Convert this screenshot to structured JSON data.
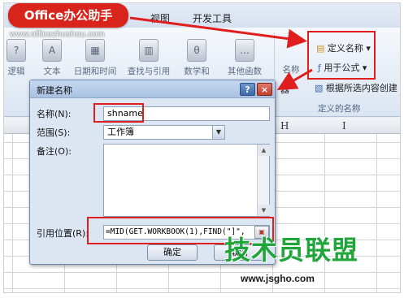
{
  "logo": {
    "text": "Office办公助手",
    "url": "www.officezhushou.com"
  },
  "tabs": [
    "视图",
    "开发工具"
  ],
  "ribbon_buttons": [
    "逻辑",
    "文本",
    "日期和时间",
    "查找与引用",
    "数学和",
    "其他函数",
    "名称"
  ],
  "define_name": {
    "define_label": "定义名称",
    "use_in_formula_label": "用于公式",
    "create_from_selection_label": "根据所选内容创建",
    "manager_label": "器",
    "group_label": "定义的名称"
  },
  "columns": [
    "H",
    "I"
  ],
  "dialog": {
    "title": "新建名称",
    "help": "?",
    "close": "×",
    "name_label": "名称(N):",
    "name_value": "shname",
    "scope_label": "范围(S):",
    "scope_value": "工作簿",
    "comment_label": "备注(O):",
    "comment_value": "",
    "ref_label": "引用位置(R):",
    "ref_value": "=MID(GET.WORKBOOK(1),FIND(\"]\",",
    "ok_label": "确定",
    "cancel_label": "取消"
  },
  "watermark": {
    "title": "技术员联盟",
    "url": "www.jsgho.com"
  },
  "colors": {
    "accent_red": "#e01e1e",
    "logo_red": "#d9241c",
    "watermark_green": "#1fa53a"
  }
}
